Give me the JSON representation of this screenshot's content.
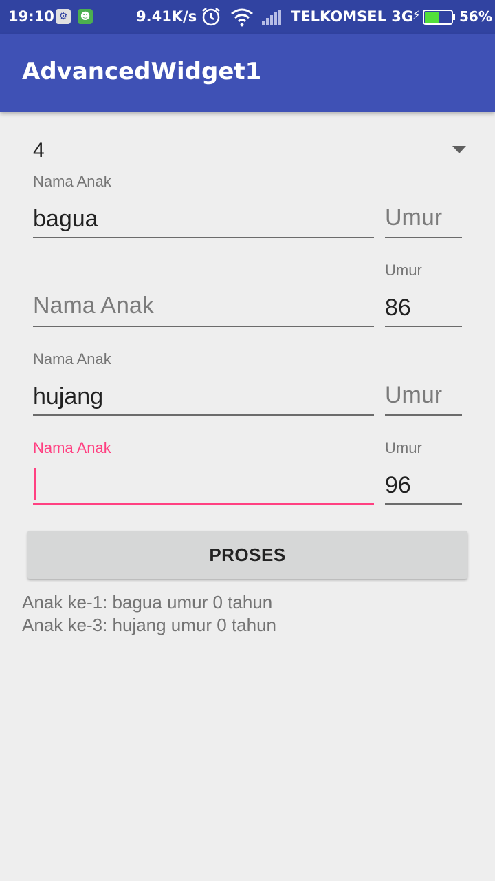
{
  "status_bar": {
    "time": "19:10",
    "net_speed": "9.41K/s",
    "carrier": "TELKOMSEL 3G",
    "battery_percent": "56%",
    "battery_level": 0.56,
    "icons": [
      "notification-app-icon",
      "notification-game-icon",
      "alarm-icon",
      "wifi-icon",
      "signal-icon",
      "charging-icon",
      "battery-icon"
    ]
  },
  "app_bar": {
    "title": "AdvancedWidget1"
  },
  "spinner": {
    "selected": "4"
  },
  "rows": [
    {
      "name_label": "Nama Anak",
      "name_value": "bagua",
      "name_hint": "",
      "age_label": "",
      "age_value": "",
      "age_hint": "Umur"
    },
    {
      "name_label": "",
      "name_value": "",
      "name_hint": "Nama Anak",
      "age_label": "Umur",
      "age_value": "86",
      "age_hint": ""
    },
    {
      "name_label": "Nama Anak",
      "name_value": "hujang",
      "name_hint": "",
      "age_label": "",
      "age_value": "",
      "age_hint": "Umur"
    },
    {
      "name_label": "Nama Anak",
      "name_value": "",
      "name_hint": "",
      "age_label": "Umur",
      "age_value": "96",
      "age_hint": ""
    }
  ],
  "button": {
    "label": "PROSES"
  },
  "results": [
    "Anak ke-1: bagua umur 0 tahun",
    "Anak ke-3: hujang umur 0 tahun"
  ],
  "colors": {
    "primary": "#3f51b5",
    "primary_dark": "#3143a1",
    "accent": "#ff4081",
    "background": "#eeeeee"
  }
}
